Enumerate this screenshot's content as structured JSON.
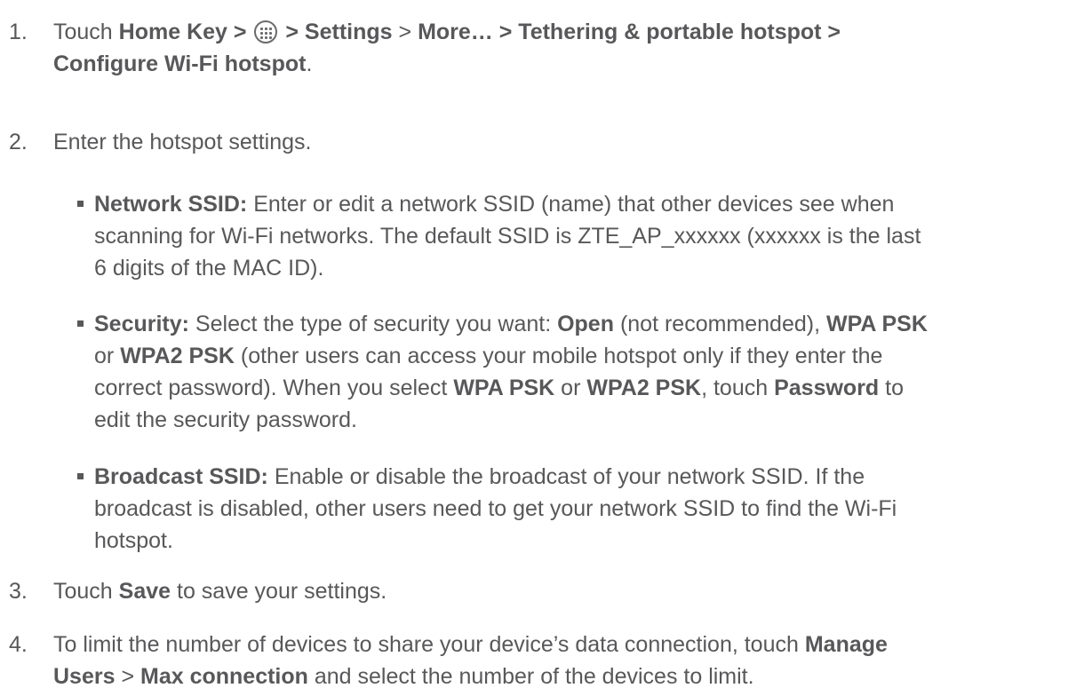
{
  "steps": [
    {
      "number": "1.",
      "parts": {
        "p1": "Touch ",
        "b1": "Home Key > ",
        "b2": " > Settings",
        "p2": " > ",
        "b3": "More… > Tethering & portable hotspot >",
        "b4": "Configure Wi-Fi hotspot",
        "p3": "."
      }
    },
    {
      "number": "2.",
      "text": "Enter the hotspot settings."
    },
    {
      "number": "3.",
      "parts": {
        "p1": "Touch ",
        "b1": "Save",
        "p2": " to save your settings."
      }
    },
    {
      "number": "4.",
      "parts": {
        "p1": "To limit the number of devices to share your device’s data connection, touch ",
        "b1": "Manage",
        "b2": "Users",
        "p2": " > ",
        "b3": "Max connection",
        "p3": " and select the number of the devices to limit."
      }
    }
  ],
  "bullets": [
    {
      "term": "Network SSID:",
      "lines": [
        " Enter or edit a network SSID (name) that other devices see when",
        "scanning for Wi-Fi networks. The default SSID is ZTE_AP_xxxxxx (xxxxxx is the last",
        "6 digits of the MAC ID)."
      ]
    },
    {
      "term": "Security:",
      "parts": {
        "p1": " Select the type of security you want: ",
        "b1": "Open",
        "p2": " (not recommended), ",
        "b2": "WPA PSK",
        "p3": "or ",
        "b3": "WPA2 PSK",
        "p4": " (other users can access your mobile hotspot only if they enter the",
        "p5": "correct password). When you select ",
        "b4": "WPA PSK",
        "p6": " or ",
        "b5": "WPA2 PSK",
        "p7": ", touch ",
        "b6": "Password",
        "p8": " to",
        "p9": "edit the security password."
      }
    },
    {
      "term": "Broadcast SSID:",
      "lines": [
        " Enable or disable the broadcast of your network SSID. If the",
        "broadcast is disabled, other users need to get your network SSID to find the Wi-Fi",
        "hotspot."
      ]
    }
  ],
  "icons": {
    "apps": "apps-launcher-icon"
  },
  "colors": {
    "text": "#58585a"
  }
}
